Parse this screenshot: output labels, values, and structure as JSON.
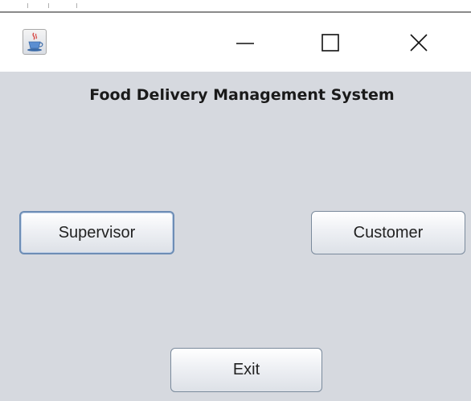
{
  "window": {
    "title": ""
  },
  "main": {
    "heading": "Food Delivery Management System",
    "buttons": {
      "supervisor": "Supervisor",
      "customer": "Customer",
      "exit": "Exit"
    }
  },
  "icons": {
    "app": "java-cup-icon",
    "minimize": "minimize-icon",
    "maximize": "maximize-icon",
    "close": "close-icon"
  },
  "colors": {
    "content_background": "#d6d9df",
    "button_border": "#7a8a9c",
    "focus_border": "#6d8db5"
  }
}
